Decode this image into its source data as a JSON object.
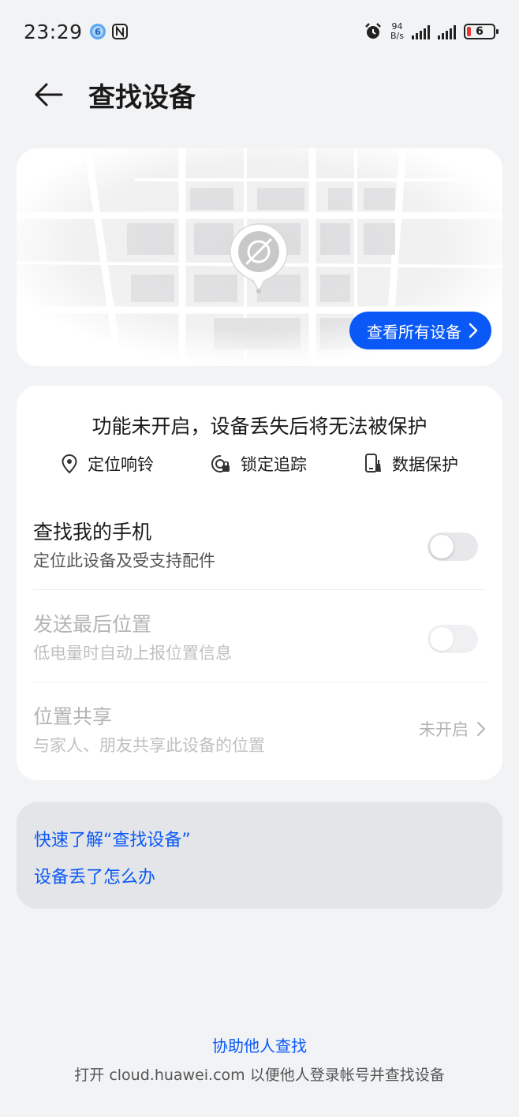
{
  "status_bar": {
    "time": "23:29",
    "net_speed_value": "94",
    "net_speed_unit": "B/s",
    "battery_level": "6",
    "icons": [
      "bubble-6-icon",
      "nfc-icon",
      "alarm-icon",
      "signal-icon",
      "signal-icon",
      "battery-icon"
    ]
  },
  "header": {
    "title": "查找设备"
  },
  "map_card": {
    "view_all_label": "查看所有设备"
  },
  "main_card": {
    "warning": "功能未开启，设备丢失后将无法被保护",
    "features": [
      {
        "icon": "location-pin-icon",
        "label": "定位响铃"
      },
      {
        "icon": "lock-track-icon",
        "label": "锁定追踪"
      },
      {
        "icon": "phone-clean-icon",
        "label": "数据保护"
      }
    ],
    "rows": [
      {
        "title": "查找我的手机",
        "subtitle": "定位此设备及受支持配件",
        "toggle_on": false,
        "enabled": true
      },
      {
        "title": "发送最后位置",
        "subtitle": "低电量时自动上报位置信息",
        "toggle_on": false,
        "enabled": false
      },
      {
        "title": "位置共享",
        "subtitle": "与家人、朋友共享此设备的位置",
        "value": "未开启",
        "enabled": false
      }
    ]
  },
  "help_card": {
    "links": [
      "快速了解“查找设备”",
      "设备丢了怎么办"
    ]
  },
  "footer": {
    "link": "协助他人查找",
    "note": "打开 cloud.huawei.com 以便他人登录帐号并查找设备"
  },
  "colors": {
    "accent": "#0a59f7",
    "background": "#f1f3f5",
    "card": "#ffffff",
    "battery_low": "#e53935"
  }
}
